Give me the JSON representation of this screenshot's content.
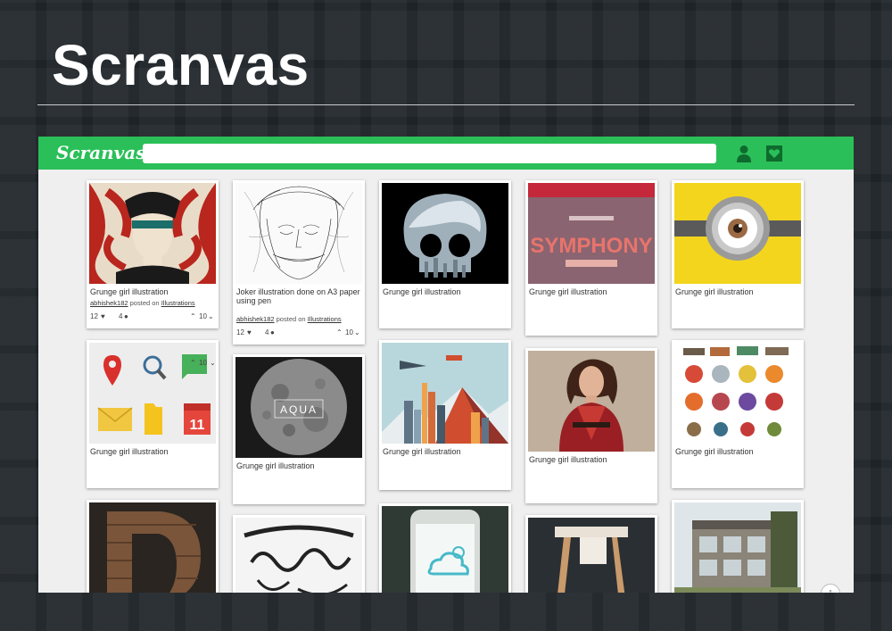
{
  "slide": {
    "title": "Scranvas"
  },
  "app": {
    "logo": "Scranvas",
    "search": {
      "value": "",
      "placeholder": ""
    },
    "icons": {
      "user": "user-icon",
      "collect": "collect-icon"
    }
  },
  "cards": [
    {
      "caption": "Grunge girl illustration",
      "author": "abhishek182",
      "posted_on": "posted on",
      "category": "Illustrations",
      "likes": "12",
      "comments": "4",
      "upvotes": "10"
    },
    {
      "caption": "Joker illustration done on A3 paper using pen",
      "author": "abhishek182",
      "posted_on": "posted on",
      "category": "Illustrations",
      "likes": "12",
      "comments": "4",
      "upvotes": "10"
    },
    {
      "caption": "Grunge girl illustration"
    },
    {
      "caption": "Grunge girl illustration"
    },
    {
      "caption": "Grunge girl illustration"
    },
    {
      "caption": "Grunge girl illustration",
      "upvotes": "10"
    },
    {
      "caption": "Grunge girl illustration",
      "overlay_text": "AQUA"
    },
    {
      "caption": "Grunge girl illustration"
    },
    {
      "caption": "Grunge girl illustration"
    },
    {
      "caption": "Grunge girl illustration"
    },
    {
      "caption": ""
    },
    {
      "caption": ""
    },
    {
      "caption": ""
    },
    {
      "caption": ""
    },
    {
      "caption": ""
    }
  ],
  "colors": {
    "brand_green": "#2bbf59",
    "background": "#efefef"
  }
}
